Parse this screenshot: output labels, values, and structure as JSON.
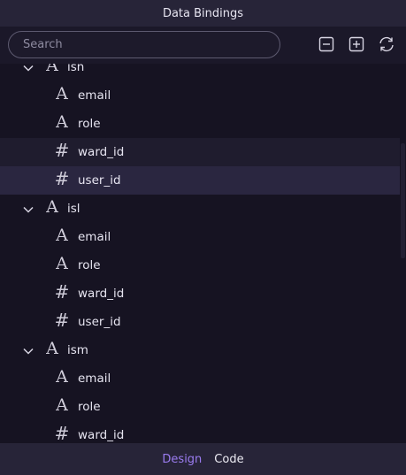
{
  "window": {
    "title": "Data Bindings"
  },
  "search": {
    "placeholder": "Search",
    "value": ""
  },
  "toolbar": {
    "collapse_icon": "minus-square-icon",
    "expand_icon": "plus-square-icon",
    "refresh_icon": "refresh-icon"
  },
  "tree": {
    "groups": [
      {
        "name": "isn",
        "expanded": true,
        "fields": [
          {
            "name": "email",
            "type": "text"
          },
          {
            "name": "role",
            "type": "text"
          },
          {
            "name": "ward_id",
            "type": "number"
          },
          {
            "name": "user_id",
            "type": "number"
          }
        ]
      },
      {
        "name": "isl",
        "expanded": true,
        "fields": [
          {
            "name": "email",
            "type": "text"
          },
          {
            "name": "role",
            "type": "text"
          },
          {
            "name": "ward_id",
            "type": "number"
          },
          {
            "name": "user_id",
            "type": "number"
          }
        ]
      },
      {
        "name": "ism",
        "expanded": true,
        "fields": [
          {
            "name": "email",
            "type": "text"
          },
          {
            "name": "role",
            "type": "text"
          },
          {
            "name": "ward_id",
            "type": "number"
          }
        ]
      }
    ],
    "hovered_row": "isn.ward_id",
    "selected_row": "isn.user_id",
    "text_type_glyph": "A",
    "number_type_glyph": "#"
  },
  "footer": {
    "tabs": [
      {
        "label": "Design",
        "active": true
      },
      {
        "label": "Code",
        "active": false
      }
    ]
  },
  "colors": {
    "background": "#161322",
    "header": "#272438",
    "accent": "#9b7cf0",
    "selected_row": "#2a2640",
    "hover_row": "#1f1c2e"
  }
}
